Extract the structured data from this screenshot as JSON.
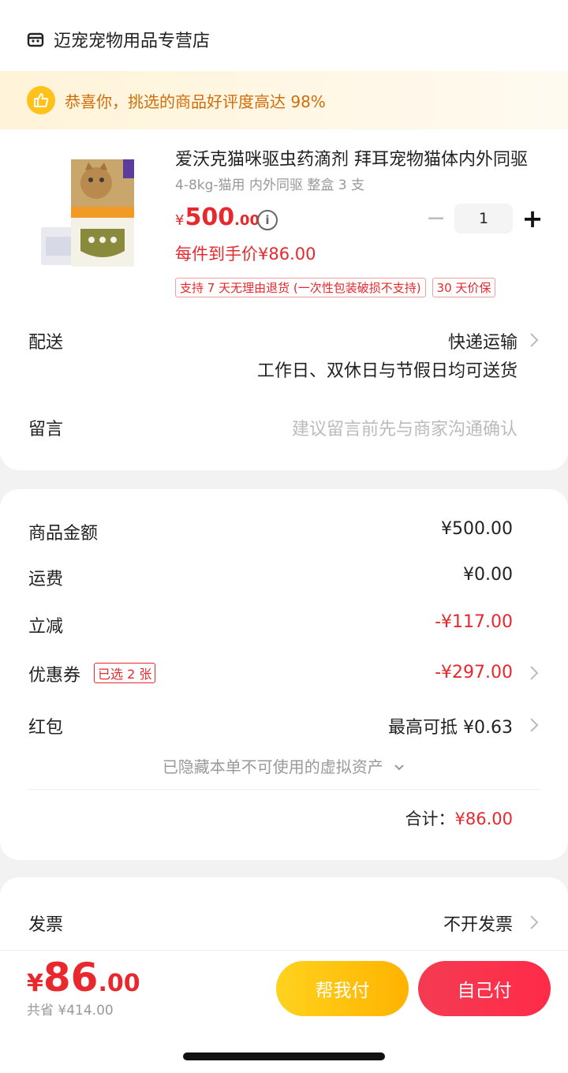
{
  "store": {
    "name": "迈宠宠物用品专营店",
    "icon": "store-icon"
  },
  "banner": {
    "text": "恭喜你，挑选的商品好评度高达 98%",
    "icon": "thumbs-up-icon"
  },
  "product": {
    "title": "爱沃克猫咪驱虫药滴剂 拜耳宠物猫体内外同驱",
    "spec": "4-8kg-猫用 内外同驱 整盒 3 支",
    "price_symbol": "¥",
    "price_int": "500",
    "price_dec": ".00",
    "final_price": "每件到手价¥86.00",
    "quantity": "1",
    "minus_label": "−",
    "plus_label": "+",
    "tags": [
      "支持 7 天无理由退货 (一次性包装破损不支持)",
      "30 天价保"
    ]
  },
  "delivery": {
    "label": "配送",
    "method": "快递运输",
    "note": "工作日、双休日与节假日均可送货"
  },
  "message": {
    "label": "留言",
    "placeholder": "建议留言前先与商家沟通确认"
  },
  "summary": {
    "goods_label": "商品金额",
    "goods_value": "¥500.00",
    "shipping_label": "运费",
    "shipping_value": "¥0.00",
    "discount_label": "立减",
    "discount_value": "-¥117.00",
    "coupon_label": "优惠券",
    "coupon_tag": "已选 2 张",
    "coupon_value": "-¥297.00",
    "redpacket_label": "红包",
    "redpacket_value": "最高可抵 ¥0.63",
    "hidden_assets": "已隐藏本单不可使用的虚拟资产",
    "total_label": "合计：",
    "total_value": "¥86.00"
  },
  "invoice": {
    "label": "发票",
    "value": "不开发票"
  },
  "footer": {
    "price_symbol": "¥",
    "price_int": "86",
    "price_dec": ".00",
    "saved": "共省 ¥414.00",
    "help_pay": "帮我付",
    "self_pay": "自己付"
  },
  "colors": {
    "accent_red": "#e8282d",
    "banner_orange": "#d26c0a",
    "yellow": "#ffc21a"
  }
}
